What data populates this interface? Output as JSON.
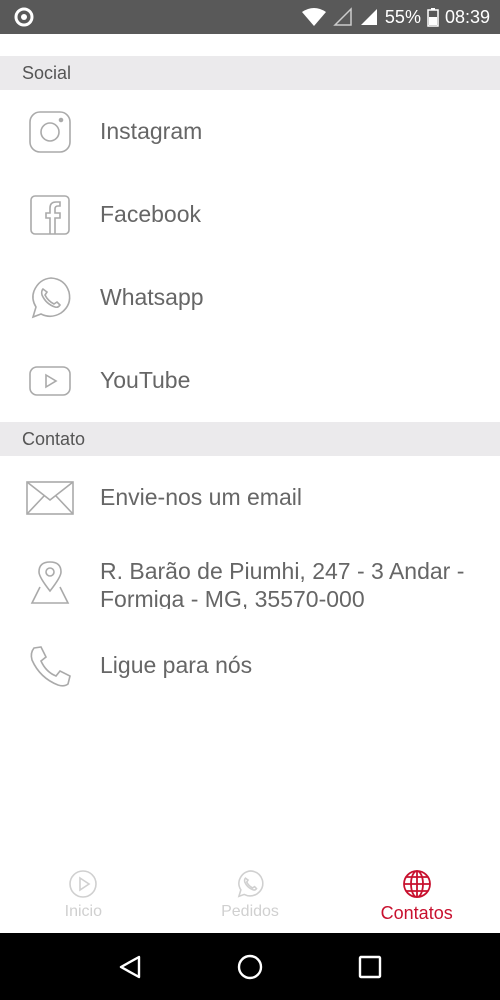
{
  "status_bar": {
    "battery": "55%",
    "time": "08:39"
  },
  "sections": {
    "social": {
      "title": "Social",
      "items": [
        {
          "label": "Instagram",
          "icon": "instagram-icon"
        },
        {
          "label": "Facebook",
          "icon": "facebook-icon"
        },
        {
          "label": "Whatsapp",
          "icon": "whatsapp-icon"
        },
        {
          "label": "YouTube",
          "icon": "youtube-icon"
        }
      ]
    },
    "contato": {
      "title": "Contato",
      "items": [
        {
          "label": "Envie-nos um email",
          "icon": "email-icon"
        },
        {
          "label": " R. Barão de Piumhi, 247 - 3 Andar - Formiga - MG, 35570-000",
          "icon": "map-pin-icon"
        },
        {
          "label": "Ligue para nós",
          "icon": "phone-icon"
        }
      ]
    }
  },
  "tabbar": {
    "tabs": [
      {
        "label": "Inicio",
        "icon": "play-icon",
        "active": false
      },
      {
        "label": "Pedidos",
        "icon": "whatsapp-icon",
        "active": false
      },
      {
        "label": "Contatos",
        "icon": "globe-icon",
        "active": true
      }
    ],
    "active_color": "#c8102e",
    "inactive_color": "#d0d0d0"
  }
}
